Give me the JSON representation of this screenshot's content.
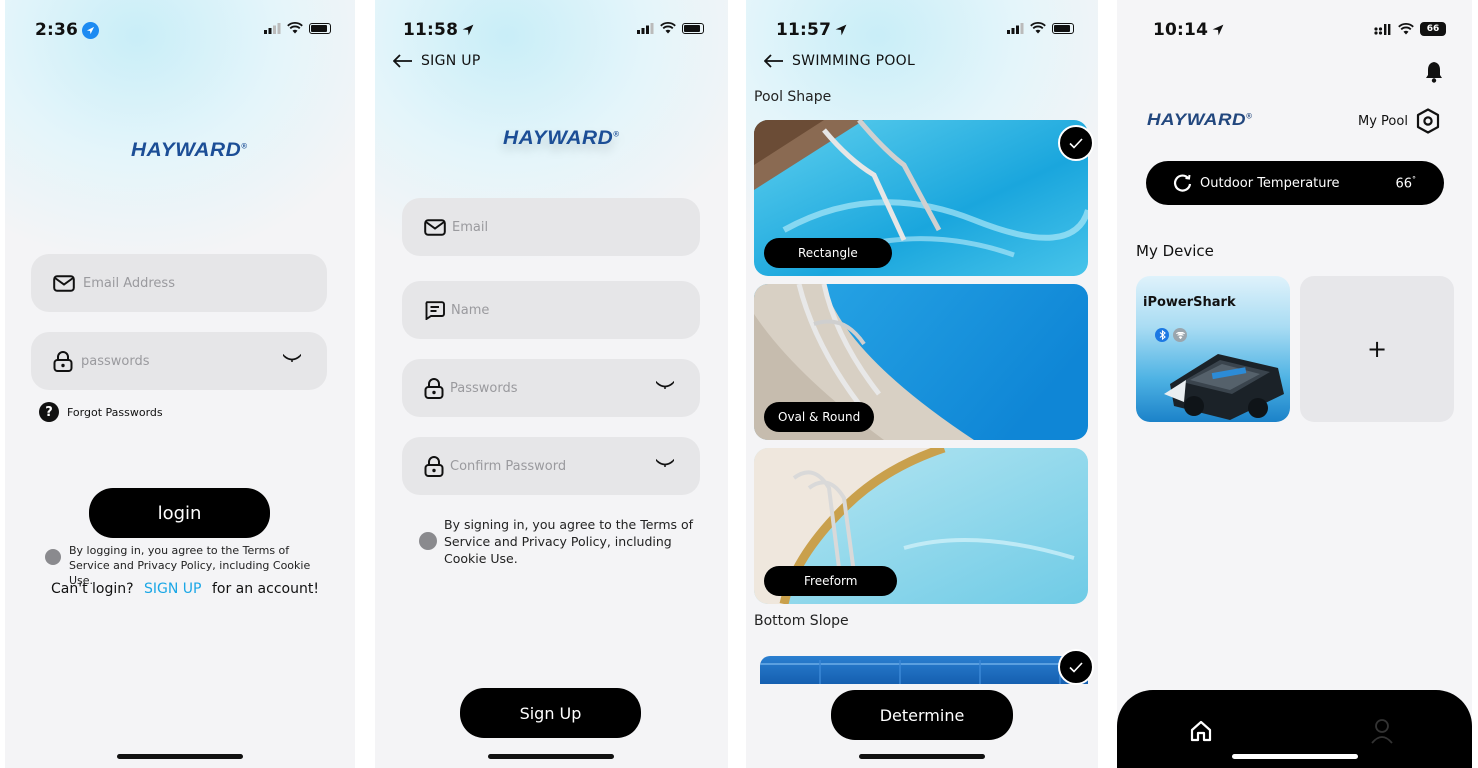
{
  "brand": {
    "logo": "HAYWARD"
  },
  "login_screen": {
    "time": "2:36",
    "email_placeholder": "Email Address",
    "password_placeholder": "passwords",
    "forgot_label": "Forgot Passwords",
    "login_label": "login",
    "terms_text": "By logging in, you agree to the Terms of Service and Privacy Policy, including Cookie Use.",
    "cant_login_prefix": "Can't login?",
    "signup_link": "SIGN UP",
    "cant_login_suffix": "for an account!",
    "colors": {
      "link": "#1aa7e6",
      "glow": "#c9eef8"
    }
  },
  "signup_screen": {
    "time": "11:58",
    "back_title": "SIGN UP",
    "email_placeholder": "Email",
    "name_placeholder": "Name",
    "password_placeholder": "Passwords",
    "confirm_placeholder": "Confirm Password",
    "terms_text": "By signing in, you agree to the Terms of Service and Privacy Policy, including Cookie Use.",
    "submit_label": "Sign Up"
  },
  "pool_screen": {
    "time": "11:57",
    "back_title": "SWIMMING POOL",
    "section_shape": "Pool Shape",
    "shapes": [
      {
        "label": "Rectangle",
        "selected": true
      },
      {
        "label": "Oval & Round",
        "selected": false
      },
      {
        "label": "Freeform",
        "selected": false
      }
    ],
    "section_slope": "Bottom Slope",
    "determine_label": "Determine"
  },
  "home_screen": {
    "time": "10:14",
    "battery": "66",
    "my_pool_label": "My Pool",
    "outdoor_label": "Outdoor Temperature",
    "outdoor_value": "66",
    "outdoor_unit": "°",
    "my_device_label": "My Device",
    "device_name": "iPowerShark",
    "add_label": "+"
  }
}
